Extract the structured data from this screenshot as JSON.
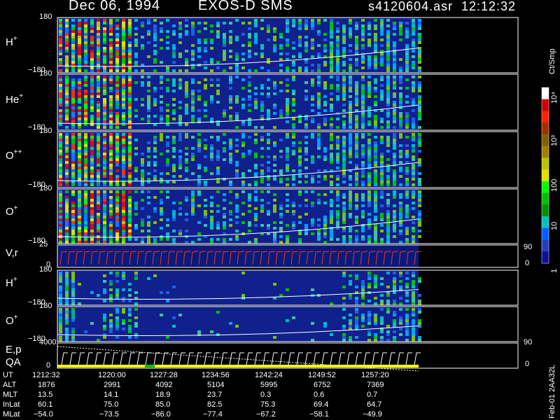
{
  "header": {
    "date": "Dec 06, 1994",
    "instrument": "EXOS-D SMS",
    "file": "s4120604.asr",
    "time": "12:12:32"
  },
  "panels": [
    {
      "id": "h1",
      "label_base": "H",
      "label_sup": "+",
      "ytop": "180",
      "ybot": "−180"
    },
    {
      "id": "he",
      "label_base": "He",
      "label_sup": "+",
      "ytop": "180",
      "ybot": "−180"
    },
    {
      "id": "opp",
      "label_base": "O",
      "label_sup": "++",
      "ytop": "180",
      "ybot": "−180"
    },
    {
      "id": "o1",
      "label_base": "O",
      "label_sup": "+",
      "ytop": "180",
      "ybot": "−180"
    },
    {
      "id": "vr",
      "label_base": "V,r",
      "label_sup": "",
      "ytop": "25",
      "ybot": "0",
      "right_top": "90",
      "right_bot": "0"
    },
    {
      "id": "h2",
      "label_base": "H",
      "label_sup": "+",
      "ytop": "180",
      "ybot": "−180"
    },
    {
      "id": "o2",
      "label_base": "O",
      "label_sup": "+",
      "ytop": "180",
      "ybot": "−180"
    },
    {
      "id": "ep",
      "label_base": "E,p",
      "label_sup": "",
      "label2": "QA",
      "ytop": "4000",
      "ybot": "0",
      "right_top": "90",
      "right_bot": "0"
    }
  ],
  "colorbar": {
    "unit": "Ct/Smp",
    "ticks": [
      "10⁴",
      "10³",
      "100",
      "10",
      "1"
    ],
    "colors": [
      "#ffffff",
      "#d00000",
      "#ff2000",
      "#a03000",
      "#806000",
      "#a08000",
      "#c0c000",
      "#e0e000",
      "#00ff00",
      "#00c000",
      "#009000",
      "#00c0c0",
      "#0060ff",
      "#2040c0",
      "#101090"
    ]
  },
  "footnote": "Feb-01 2AA32L",
  "table": {
    "rows": [
      {
        "name": "UT",
        "values": [
          "1212:32",
          "1220:00",
          "1227:28",
          "1234:56",
          "1242:24",
          "1249:52",
          "1257:20"
        ]
      },
      {
        "name": "ALT",
        "values": [
          "1876",
          "2991",
          "4092",
          "5104",
          "5995",
          "6752",
          "7369"
        ]
      },
      {
        "name": "MLT",
        "values": [
          "13.5",
          "14.1",
          "18.9",
          "23.7",
          "0.3",
          "0.6",
          "0.7"
        ]
      },
      {
        "name": "InLat",
        "values": [
          "60.1",
          "75.0",
          "85.0",
          "82.5",
          "75.3",
          "69.4",
          "64.7"
        ]
      },
      {
        "name": "MLat",
        "values": [
          "−54.0",
          "−73.5",
          "−86.0",
          "−77.4",
          "−67.2",
          "−58.1",
          "−49.9"
        ]
      }
    ]
  },
  "chart_data": {
    "type": "heatmap",
    "title": "Dec 06, 1994 EXOS-D SMS",
    "x": [
      "1212:32",
      "1220:00",
      "1227:28",
      "1234:56",
      "1242:24",
      "1249:52",
      "1257:20"
    ],
    "series": [
      {
        "name": "H+",
        "ylim": [
          -180,
          180
        ]
      },
      {
        "name": "He+",
        "ylim": [
          -180,
          180
        ]
      },
      {
        "name": "O++",
        "ylim": [
          -180,
          180
        ]
      },
      {
        "name": "O+",
        "ylim": [
          -180,
          180
        ]
      },
      {
        "name": "V,r",
        "ylim": [
          0,
          25
        ]
      },
      {
        "name": "H+",
        "ylim": [
          -180,
          180
        ]
      },
      {
        "name": "O+",
        "ylim": [
          -180,
          180
        ]
      },
      {
        "name": "E,p",
        "ylim": [
          0,
          4000
        ]
      }
    ],
    "colorscale": {
      "unit": "Ct/Smp",
      "scale": "log",
      "range": [
        1,
        10000
      ]
    },
    "grid": false
  }
}
